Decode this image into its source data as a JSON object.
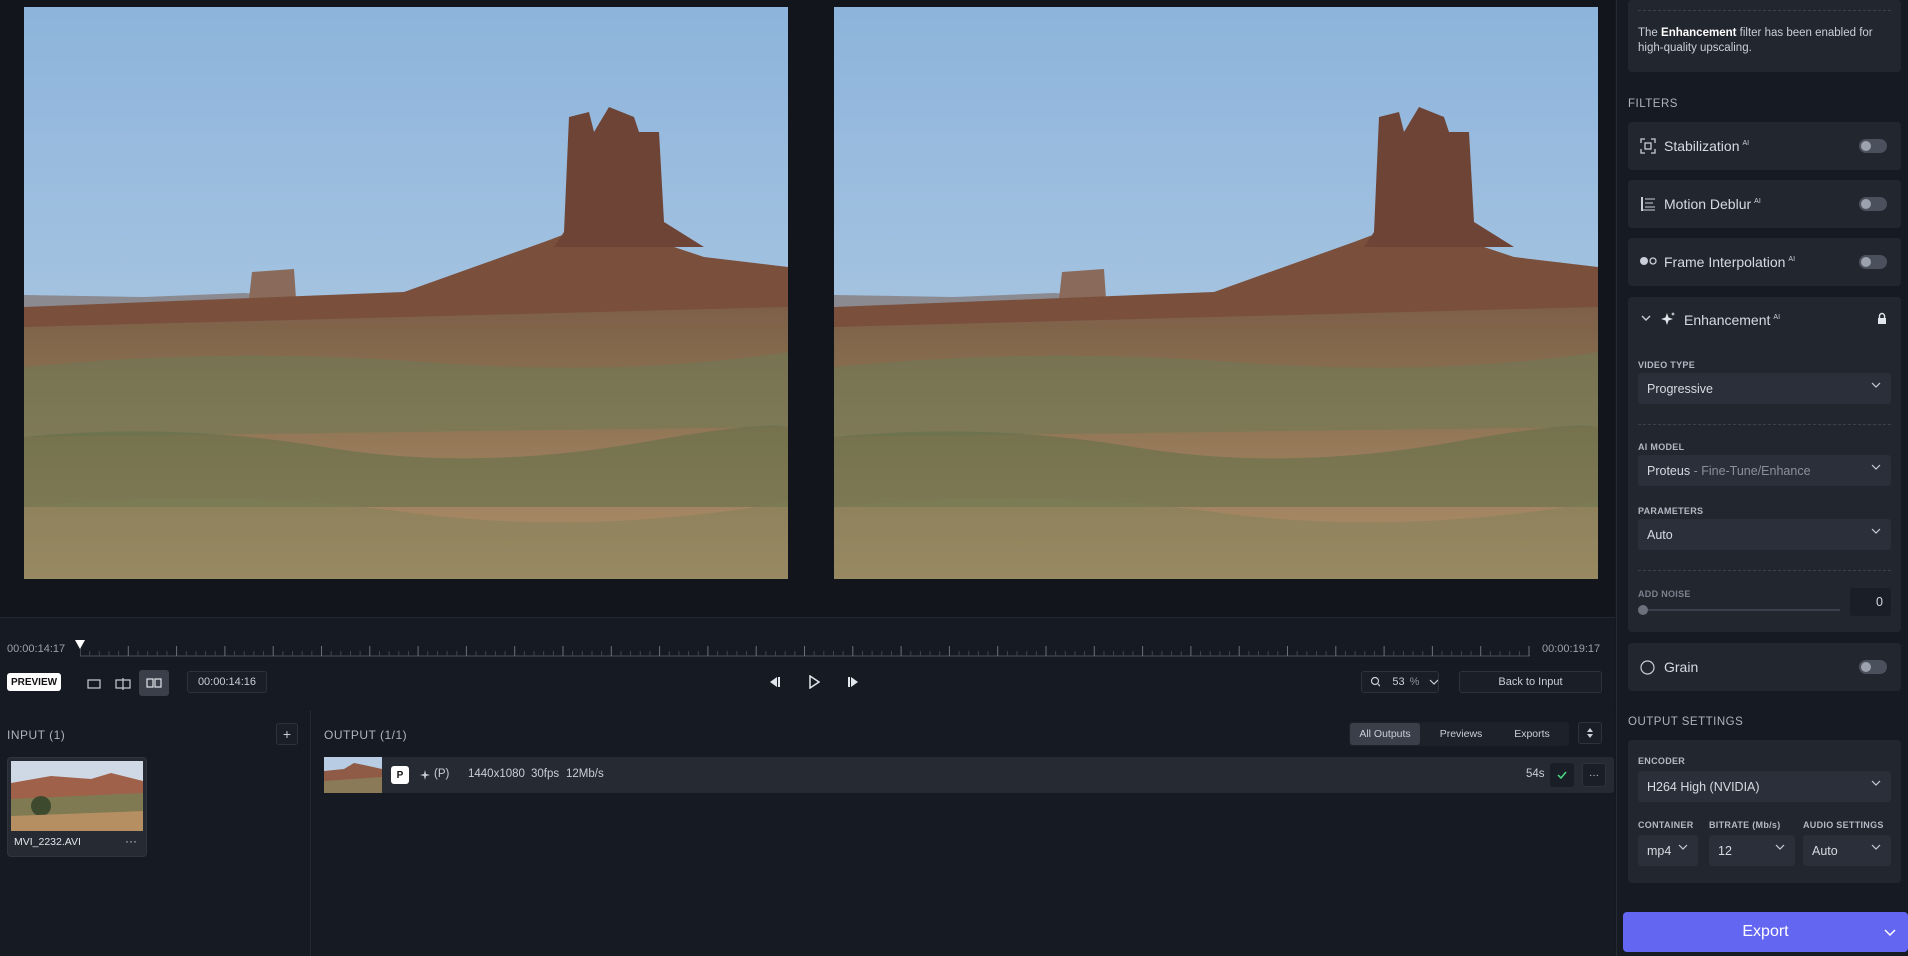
{
  "timeline": {
    "start_tc": "00:00:14:17",
    "end_tc": "00:00:19:17",
    "current_tc": "00:00:14:16",
    "preview_label": "PREVIEW",
    "zoom_value": "53",
    "zoom_unit": "%",
    "back_to_input": "Back to Input",
    "playhead_fraction": 0.001
  },
  "input": {
    "title": "INPUT (1)",
    "add_symbol": "+",
    "file_name": "MVI_2232.AVI",
    "more": "···"
  },
  "output": {
    "title": "OUTPUT (1/1)",
    "tabs": [
      "All Outputs",
      "Previews",
      "Exports"
    ],
    "active_tab": "All Outputs",
    "row": {
      "badge": "P",
      "model_tag": "(P)",
      "resolution": "1440x1080",
      "fps": "30fps",
      "bitrate": "12Mb/s",
      "duration": "54s",
      "more": "···"
    }
  },
  "sidebar": {
    "notice_bold": "Enhancement",
    "notice_pre": "The",
    "notice_post": "filter has been enabled for high-quality upscaling.",
    "filters_title": "FILTERS",
    "filters": [
      {
        "name": "Stabilization",
        "ai": "AI",
        "icon": "stabilization-icon",
        "enabled": false
      },
      {
        "name": "Motion Deblur",
        "ai": "AI",
        "icon": "motion-deblur-icon",
        "enabled": false
      },
      {
        "name": "Frame Interpolation",
        "ai": "AI",
        "icon": "frame-interpolation-icon",
        "enabled": false
      }
    ],
    "enhancement": {
      "name": "Enhancement",
      "ai": "AI",
      "video_type_label": "VIDEO TYPE",
      "video_type": "Progressive",
      "ai_model_label": "AI MODEL",
      "ai_model": "Proteus",
      "ai_model_sub": " - Fine-Tune/Enhance",
      "parameters_label": "PARAMETERS",
      "parameters": "Auto",
      "add_noise_label": "ADD NOISE",
      "add_noise_value": "0"
    },
    "grain": {
      "name": "Grain",
      "enabled": false
    },
    "output_settings_title": "OUTPUT SETTINGS",
    "encoder_label": "ENCODER",
    "encoder": "H264 High (NVIDIA)",
    "container_label": "CONTAINER",
    "container": "mp4",
    "bitrate_label": "BITRATE (Mb/s)",
    "bitrate": "12",
    "audio_label": "AUDIO SETTINGS",
    "audio": "Auto",
    "export_label": "Export"
  },
  "colors": {
    "accent": "#6366f1",
    "panel": "#161a22",
    "card": "#22262f"
  }
}
